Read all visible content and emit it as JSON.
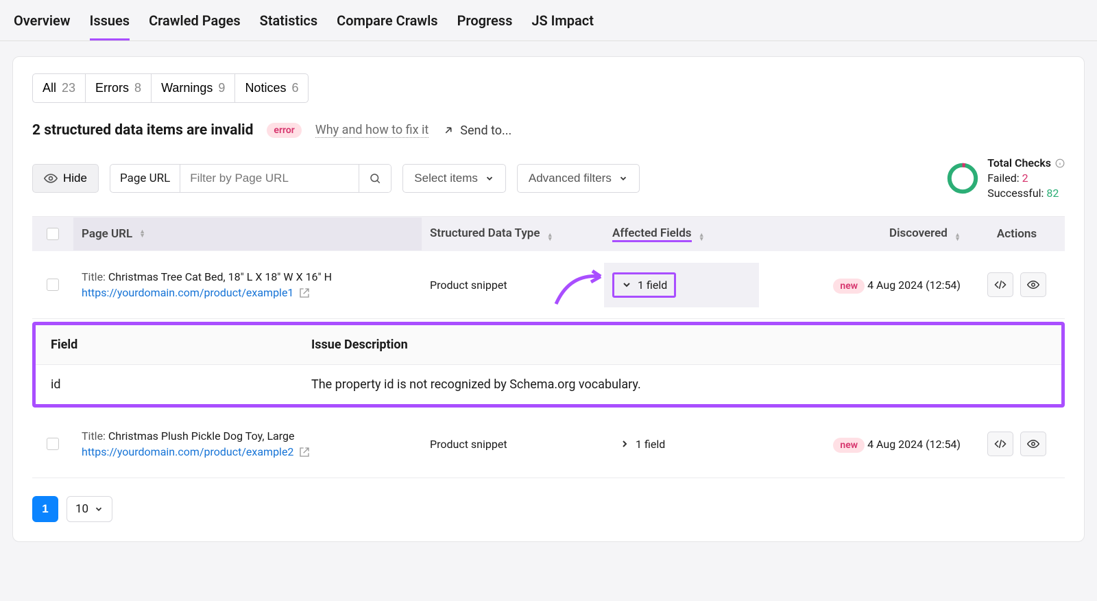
{
  "tabs": [
    "Overview",
    "Issues",
    "Crawled Pages",
    "Statistics",
    "Compare Crawls",
    "Progress",
    "JS Impact"
  ],
  "active_tab": "Issues",
  "filters": [
    {
      "label": "All",
      "count": "23"
    },
    {
      "label": "Errors",
      "count": "8"
    },
    {
      "label": "Warnings",
      "count": "9"
    },
    {
      "label": "Notices",
      "count": "6"
    }
  ],
  "heading": "2 structured data items are invalid",
  "heading_badge": "error",
  "help_link": "Why and how to fix it",
  "send_to": "Send to...",
  "hide_label": "Hide",
  "url_label": "Page URL",
  "url_placeholder": "Filter by Page URL",
  "select_items": "Select items",
  "advanced_filters": "Advanced filters",
  "totals": {
    "title": "Total Checks",
    "failed_label": "Failed:",
    "failed": "2",
    "success_label": "Successful:",
    "success": "82"
  },
  "columns": {
    "url": "Page URL",
    "type": "Structured Data Type",
    "fields": "Affected Fields",
    "discovered": "Discovered",
    "actions": "Actions"
  },
  "rows": [
    {
      "title_prefix": "Title: ",
      "title": "Christmas Tree Cat Bed, 18\" L X 18\" W X 16\" H",
      "url": "https://yourdomain.com/product/example1",
      "type": "Product snippet",
      "fields": "1 field",
      "expanded": true,
      "badge": "new",
      "discovered": "4 Aug 2024 (12:54)"
    },
    {
      "title_prefix": "Title: ",
      "title": "Christmas Plush Pickle Dog Toy, Large",
      "url": "https://yourdomain.com/product/example2",
      "type": "Product snippet",
      "fields": "1 field",
      "expanded": false,
      "badge": "new",
      "discovered": "4 Aug 2024 (12:54)"
    }
  ],
  "details": {
    "field_header": "Field",
    "desc_header": "Issue Description",
    "field": "id",
    "desc": "The property id is not recognized by Schema.org vocabulary."
  },
  "page": "1",
  "page_size": "10"
}
